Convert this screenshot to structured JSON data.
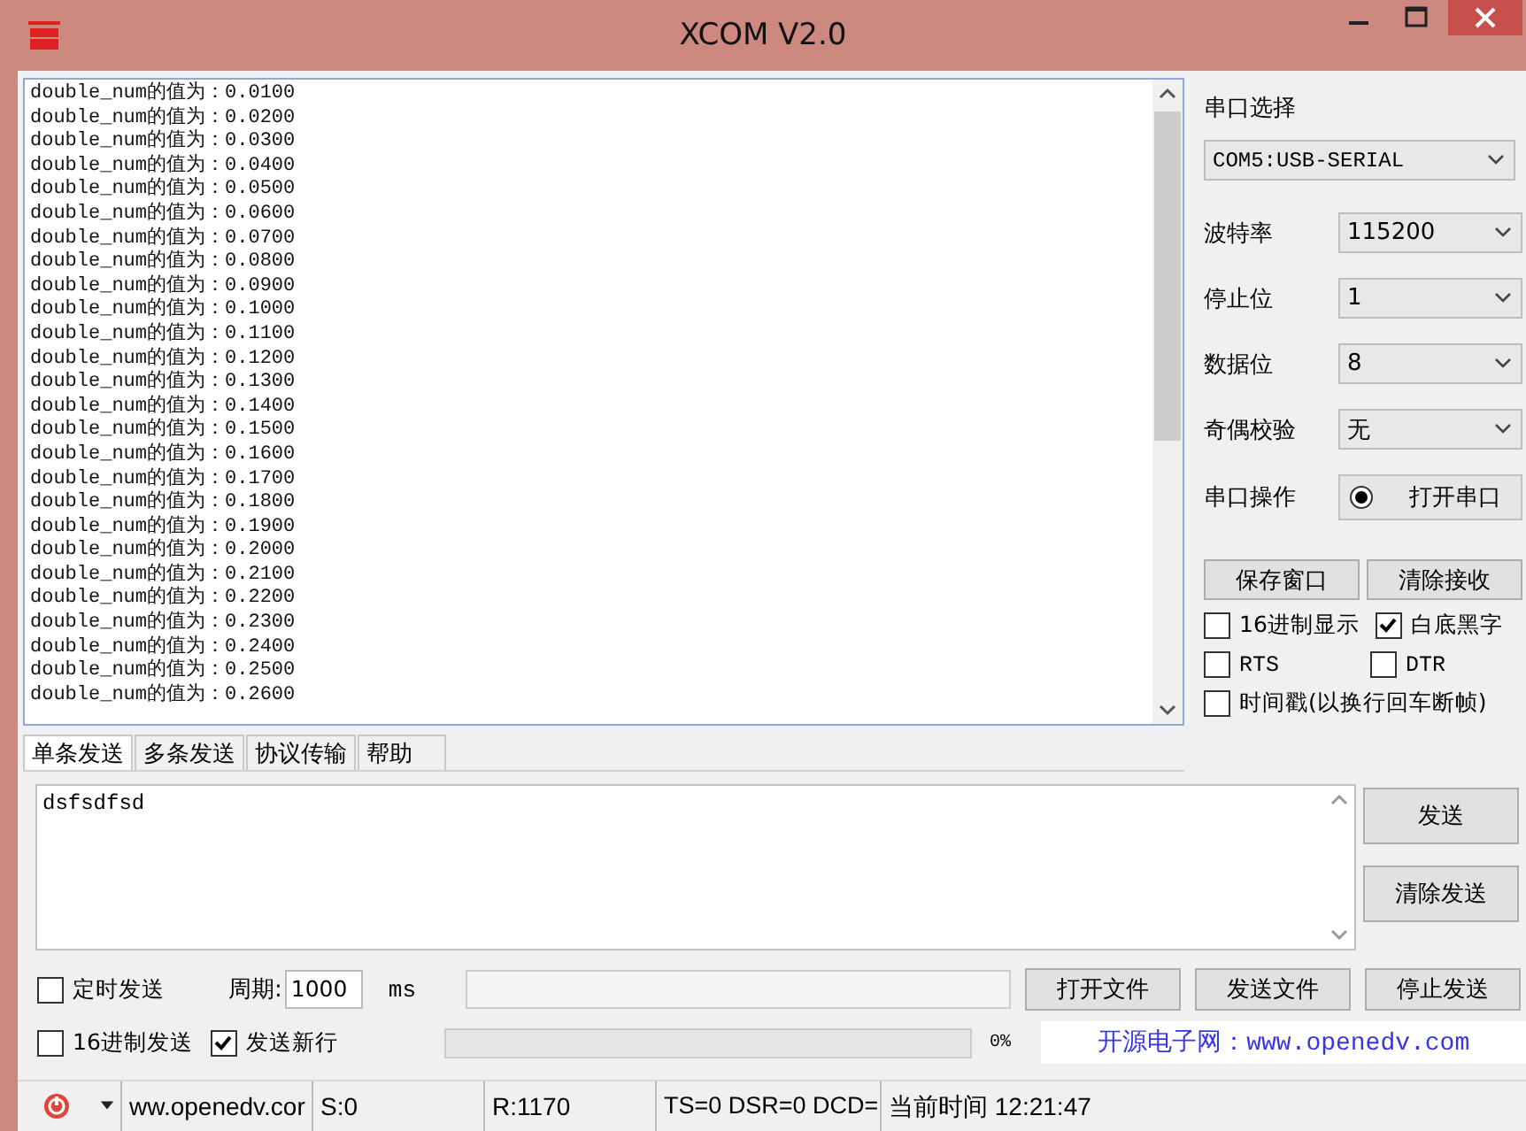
{
  "window": {
    "title": "XCOM V2.0"
  },
  "receive_log": {
    "lines": [
      "double_num的值为：0.0100",
      "double_num的值为：0.0200",
      "double_num的值为：0.0300",
      "double_num的值为：0.0400",
      "double_num的值为：0.0500",
      "double_num的值为：0.0600",
      "double_num的值为：0.0700",
      "double_num的值为：0.0800",
      "double_num的值为：0.0900",
      "double_num的值为：0.1000",
      "double_num的值为：0.1100",
      "double_num的值为：0.1200",
      "double_num的值为：0.1300",
      "double_num的值为：0.1400",
      "double_num的值为：0.1500",
      "double_num的值为：0.1600",
      "double_num的值为：0.1700",
      "double_num的值为：0.1800",
      "double_num的值为：0.1900",
      "double_num的值为：0.2000",
      "double_num的值为：0.2100",
      "double_num的值为：0.2200",
      "double_num的值为：0.2300",
      "double_num的值为：0.2400",
      "double_num的值为：0.2500",
      "double_num的值为：0.2600"
    ]
  },
  "serial_settings": {
    "title": "串口选择",
    "port": "COM5:USB-SERIAL",
    "fields": [
      {
        "label": "波特率",
        "value": "115200"
      },
      {
        "label": "停止位",
        "value": "1"
      },
      {
        "label": "数据位",
        "value": "8"
      },
      {
        "label": "奇偶校验",
        "value": "无"
      }
    ],
    "operation": {
      "label": "串口操作",
      "button": "打开串口"
    }
  },
  "receive_buttons": [
    "保存窗口",
    "清除接收"
  ],
  "receive_options": [
    {
      "label": "16进制显示",
      "checked": false
    },
    {
      "label": "白底黑字",
      "checked": true
    },
    {
      "label": "RTS",
      "checked": false
    },
    {
      "label": "DTR",
      "checked": false
    },
    {
      "label": "时间戳(以换行回车断帧)",
      "checked": false
    }
  ],
  "send_tabs": [
    {
      "label": "单条发送",
      "selected": true
    },
    {
      "label": "多条发送",
      "selected": false
    },
    {
      "label": "协议传输",
      "selected": false
    },
    {
      "label": "帮助",
      "selected": false
    }
  ],
  "send_box": {
    "value": "dsfsdfsd"
  },
  "send_buttons": [
    "发送",
    "清除发送"
  ],
  "timed_send": {
    "label": "定时发送",
    "checked": false,
    "period_label": "周期:",
    "period": "1000",
    "unit": "ms"
  },
  "hex_send": {
    "label": "16进制发送",
    "checked": false
  },
  "send_newline": {
    "label": "发送新行",
    "checked": true
  },
  "file_buttons": [
    "打开文件",
    "发送文件",
    "停止发送"
  ],
  "file_progress": {
    "level": 0,
    "reading": "0%"
  },
  "banner": "开源电子网：www.openedv.com",
  "status_bar": {
    "url": "ww.openedv.cor",
    "sent": "S:0",
    "received": "R:1170",
    "signals": "TS=0 DSR=0 DCD=",
    "time": "当前时间 12:21:47"
  }
}
